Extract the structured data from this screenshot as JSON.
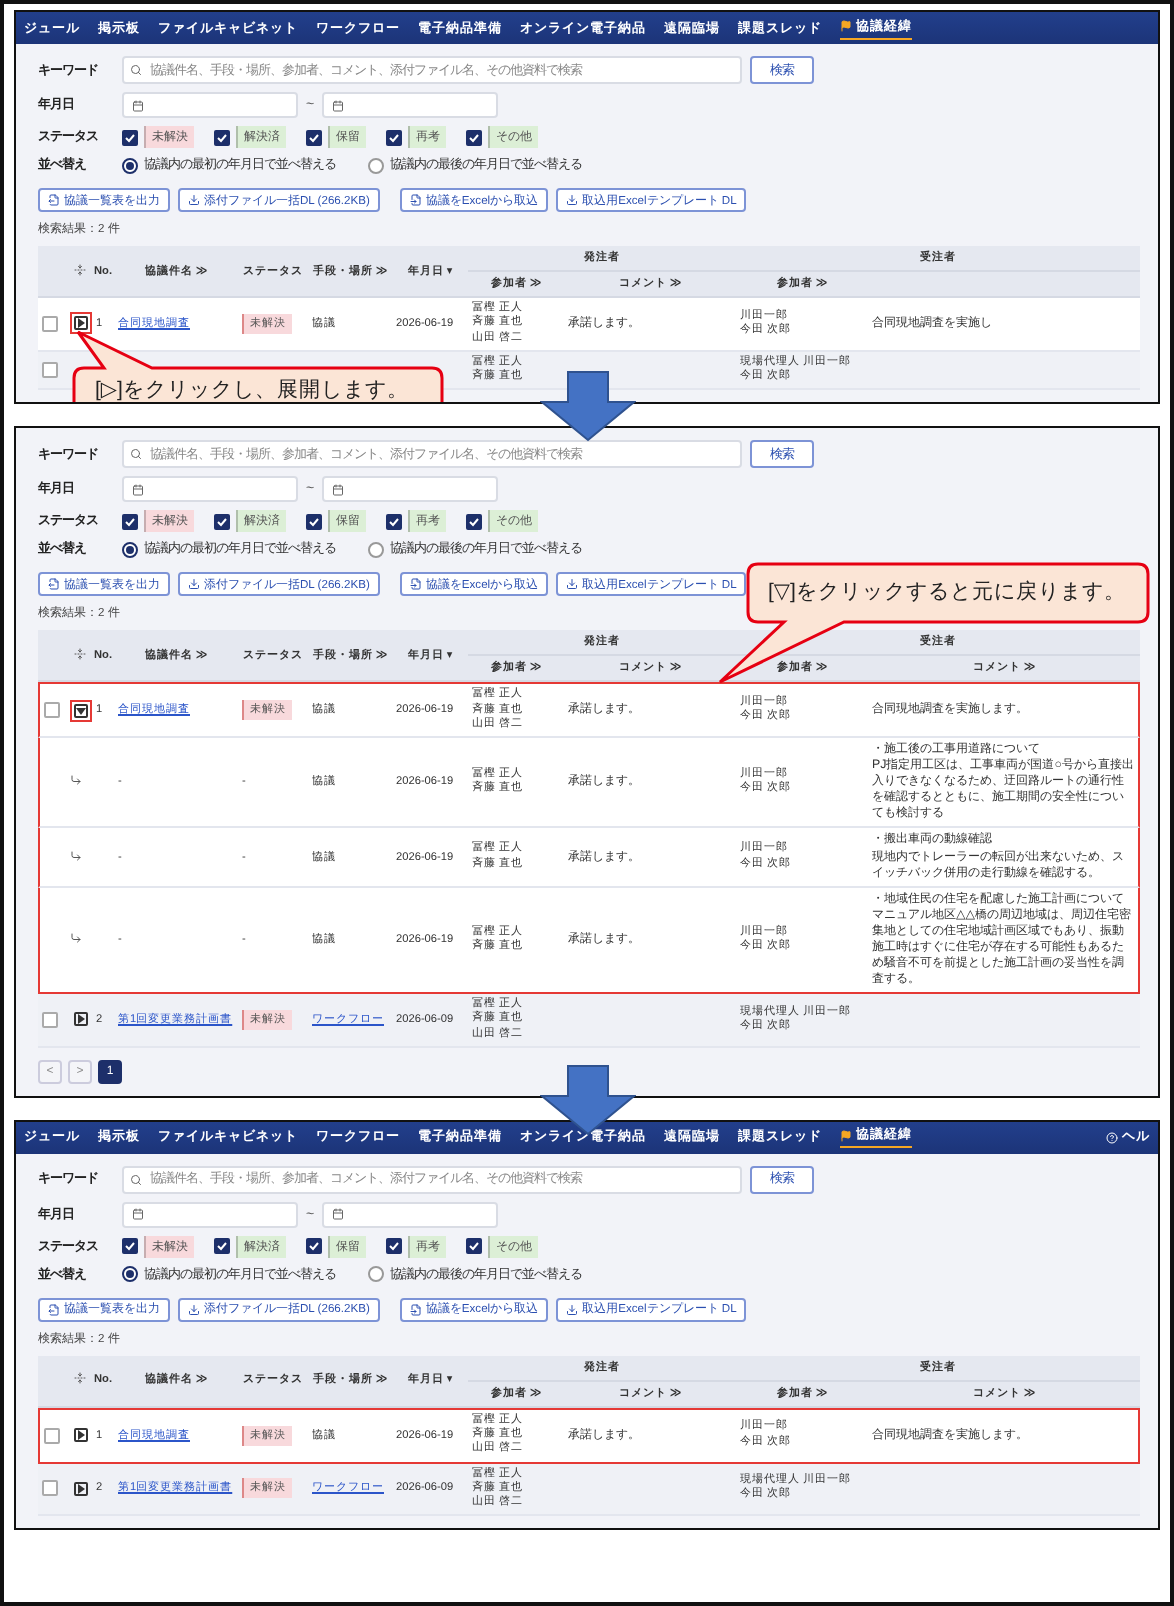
{
  "panels": [
    {
      "nav": {
        "items": [
          {
            "label": "ジュール",
            "selected": false
          },
          {
            "label": "掲示板",
            "selected": false
          },
          {
            "label": "ファイルキャビネット",
            "selected": false
          },
          {
            "label": "ワークフロー",
            "selected": false
          },
          {
            "label": "電子納品準備",
            "selected": false
          },
          {
            "label": "オンライン電子納品",
            "selected": false
          },
          {
            "label": "遠隔臨場",
            "selected": false
          },
          {
            "label": "課題スレッド",
            "selected": false
          },
          {
            "label": "協議経緯",
            "selected": true
          }
        ]
      },
      "keyword": {
        "label": "キーワード",
        "placeholder": "協議件名、手段・場所、参加者、コメント、添付ファイル名、その他資料で検索",
        "button": "検索"
      },
      "date": {
        "label": "年月日",
        "separator": "~"
      },
      "status": {
        "label": "ステータス",
        "options": [
          {
            "label": "未解決",
            "checked": true,
            "color": "#f8d9dc"
          },
          {
            "label": "解決済",
            "checked": true,
            "color": "#dcefd6"
          },
          {
            "label": "保留",
            "checked": true,
            "color": "#dcefd6"
          },
          {
            "label": "再考",
            "checked": true,
            "color": "#dcefd6"
          },
          {
            "label": "その他",
            "checked": true,
            "color": "#dcefd6"
          }
        ]
      },
      "sort": {
        "label": "並べ替え",
        "options": [
          {
            "label": "協議内の最初の年月日で並べ替える",
            "selected": true
          },
          {
            "label": "協議内の最後の年月日で並べ替える",
            "selected": false
          }
        ]
      },
      "actions": [
        "協議一覧表を出力",
        "添付ファイル一括DL (266.2KB)",
        "協議をExcelから取込",
        "取込用Excelテンプレート DL"
      ],
      "result_count": "検索結果：2 件",
      "table": {
        "columns": [
          "No.",
          "協議件名 ≫",
          "ステータス",
          "手段・場所 ≫",
          "年月日 ▾"
        ],
        "groups": [
          {
            "label": "発注者",
            "columns": [
              "参加者 ≫",
              "コメント ≫"
            ]
          },
          {
            "label": "受注者",
            "columns": [
              "参加者 ≫"
            ]
          }
        ],
        "rows": [
          {
            "selected": false,
            "expanded": false,
            "expand_highlighted": true,
            "highlighted": false,
            "no": "1",
            "title": "合同現地調査",
            "status": "未解決",
            "method": "協議",
            "method_link": false,
            "date": "2026-06-19",
            "client_participants": [
              "冨樫 正人",
              "斉藤 直也",
              "山田 啓二"
            ],
            "client_comment": "承諾します。",
            "contractor_participants": [
              "川田一郎",
              "今田 次郎"
            ],
            "contractor_comment": [
              "合同現地調査を実施し"
            ],
            "callout": {
              "kind": "below",
              "text": "[▷]をクリックし、展開します。"
            }
          },
          {
            "selected": false,
            "client_participants": [
              "冨樫 正人",
              "斉藤 直也"
            ],
            "contractor_participants": [
              "現場代理人 川田一郎",
              "今田 次郎"
            ]
          }
        ]
      }
    },
    {
      "keyword": {
        "label": "キーワード",
        "placeholder": "協議件名、手段・場所、参加者、コメント、添付ファイル名、その他資料で検索",
        "button": "検索"
      },
      "date": {
        "label": "年月日",
        "separator": "~"
      },
      "status": {
        "label": "ステータス",
        "options": [
          {
            "label": "未解決",
            "checked": true,
            "color": "#f8d9dc"
          },
          {
            "label": "解決済",
            "checked": true,
            "color": "#dcefd6"
          },
          {
            "label": "保留",
            "checked": true,
            "color": "#dcefd6"
          },
          {
            "label": "再考",
            "checked": true,
            "color": "#dcefd6"
          },
          {
            "label": "その他",
            "checked": true,
            "color": "#dcefd6"
          }
        ]
      },
      "sort": {
        "label": "並べ替え",
        "options": [
          {
            "label": "協議内の最初の年月日で並べ替える",
            "selected": true
          },
          {
            "label": "協議内の最後の年月日で並べ替える",
            "selected": false
          }
        ]
      },
      "actions": [
        "協議一覧表を出力",
        "添付ファイル一括DL (266.2KB)",
        "協議をExcelから取込",
        "取込用Excelテンプレート DL"
      ],
      "result_count": "検索結果：2 件",
      "table": {
        "columns": [
          "No.",
          "協議件名 ≫",
          "ステータス",
          "手段・場所 ≫",
          "年月日 ▾"
        ],
        "groups": [
          {
            "label": "発注者",
            "columns": [
              "参加者 ≫",
              "コメント ≫"
            ]
          },
          {
            "label": "受注者",
            "columns": [
              "参加者 ≫",
              "コメント ≫"
            ]
          }
        ],
        "rows": [
          {
            "selected": false,
            "expanded": true,
            "expand_highlighted": true,
            "highlighted": true,
            "no": "1",
            "title": "合同現地調査",
            "status": "未解決",
            "method": "協議",
            "method_link": false,
            "date": "2026-06-19",
            "client_participants": [
              "冨樫 正人",
              "斉藤 直也",
              "山田 啓二"
            ],
            "client_comment": "承諾します。",
            "contractor_participants": [
              "川田一郎",
              "今田 次郎"
            ],
            "contractor_comment": [
              "合同現地調査を実施します。"
            ],
            "callout": {
              "kind": "above",
              "text": "[▽]をクリックすると元に戻ります。"
            },
            "children": [
              {
                "title": "-",
                "status": "-",
                "method": "協議",
                "date": "2026-06-19",
                "client_participants": [
                  "冨樫 正人",
                  "斉藤 直也"
                ],
                "client_comment": "承諾します。",
                "contractor_participants": [
                  "川田一郎",
                  "今田 次郎"
                ],
                "contractor_comment": [
                  "・施工後の工事用道路について",
                  "PJ指定用工区は、工事車両が国道○号から直接出入りできなくなるため、迂回路ルートの通行性を確認するとともに、施工期間の安全性についても検討する"
                ]
              },
              {
                "title": "-",
                "status": "-",
                "method": "協議",
                "date": "2026-06-19",
                "client_participants": [
                  "冨樫 正人",
                  "斉藤 直也"
                ],
                "client_comment": "承諾します。",
                "contractor_participants": [
                  "川田一郎",
                  "今田 次郎"
                ],
                "contractor_comment": [
                  "・搬出車両の動線確認",
                  "現地内でトレーラーの転回が出来ないため、スイッチバック併用の走行動線を確認する。"
                ]
              },
              {
                "title": "-",
                "status": "-",
                "method": "協議",
                "date": "2026-06-19",
                "client_participants": [
                  "冨樫 正人",
                  "斉藤 直也"
                ],
                "client_comment": "承諾します。",
                "contractor_participants": [
                  "川田一郎",
                  "今田 次郎"
                ],
                "contractor_comment": [
                  "・地域住民の住宅を配慮した施工計画について",
                  "マニュアル地区△△橋の周辺地域は、周辺住宅密集地としての住宅地域計画区域でもあり、振動施工時はすぐに住宅が存在する可能性もあるため騒音不可を前提とした施工計画の妥当性を調査する。"
                ]
              }
            ]
          },
          {
            "selected": false,
            "expanded": false,
            "expand_highlighted": false,
            "highlighted": false,
            "no": "2",
            "title": "第1回変更業務計画書",
            "status": "未解決",
            "method": "ワークフロー",
            "method_link": true,
            "date": "2026-06-09",
            "client_participants": [
              "冨樫 正人",
              "斉藤 直也",
              "山田 啓二"
            ],
            "contractor_participants": [
              "現場代理人 川田一郎",
              "今田 次郎"
            ]
          }
        ]
      },
      "pagination": [
        {
          "label": "<",
          "selected": false
        },
        {
          "label": ">",
          "selected": false
        },
        {
          "label": "1",
          "selected": true
        }
      ]
    },
    {
      "nav": {
        "items": [
          {
            "label": "ジュール",
            "selected": false
          },
          {
            "label": "掲示板",
            "selected": false
          },
          {
            "label": "ファイルキャビネット",
            "selected": false
          },
          {
            "label": "ワークフロー",
            "selected": false
          },
          {
            "label": "電子納品準備",
            "selected": false
          },
          {
            "label": "オンライン電子納品",
            "selected": false
          },
          {
            "label": "遠隔臨場",
            "selected": false
          },
          {
            "label": "課題スレッド",
            "selected": false
          },
          {
            "label": "協議経緯",
            "selected": true
          }
        ],
        "help": "ヘル"
      },
      "keyword": {
        "label": "キーワード",
        "placeholder": "協議件名、手段・場所、参加者、コメント、添付ファイル名、その他資料で検索",
        "button": "検索"
      },
      "date": {
        "label": "年月日",
        "separator": "~"
      },
      "status": {
        "label": "ステータス",
        "options": [
          {
            "label": "未解決",
            "checked": true,
            "color": "#f8d9dc"
          },
          {
            "label": "解決済",
            "checked": true,
            "color": "#dcefd6"
          },
          {
            "label": "保留",
            "checked": true,
            "color": "#dcefd6"
          },
          {
            "label": "再考",
            "checked": true,
            "color": "#dcefd6"
          },
          {
            "label": "その他",
            "checked": true,
            "color": "#dcefd6"
          }
        ]
      },
      "sort": {
        "label": "並べ替え",
        "options": [
          {
            "label": "協議内の最初の年月日で並べ替える",
            "selected": true
          },
          {
            "label": "協議内の最後の年月日で並べ替える",
            "selected": false
          }
        ]
      },
      "actions": [
        "協議一覧表を出力",
        "添付ファイル一括DL (266.2KB)",
        "協議をExcelから取込",
        "取込用Excelテンプレート DL"
      ],
      "result_count": "検索結果：2 件",
      "table": {
        "columns": [
          "No.",
          "協議件名 ≫",
          "ステータス",
          "手段・場所 ≫",
          "年月日 ▾"
        ],
        "groups": [
          {
            "label": "発注者",
            "columns": [
              "参加者 ≫",
              "コメント ≫"
            ]
          },
          {
            "label": "受注者",
            "columns": [
              "参加者 ≫",
              "コメント ≫"
            ]
          }
        ],
        "rows": [
          {
            "selected": false,
            "expanded": false,
            "expand_highlighted": false,
            "highlighted": true,
            "no": "1",
            "title": "合同現地調査",
            "status": "未解決",
            "method": "協議",
            "method_link": false,
            "date": "2026-06-19",
            "client_participants": [
              "冨樫 正人",
              "斉藤 直也",
              "山田 啓二"
            ],
            "client_comment": "承諾します。",
            "contractor_participants": [
              "川田一郎",
              "今田 次郎"
            ],
            "contractor_comment": [
              "合同現地調査を実施します。"
            ]
          },
          {
            "selected": false,
            "expanded": false,
            "expand_highlighted": false,
            "highlighted": false,
            "no": "2",
            "title": "第1回変更業務計画書",
            "status": "未解決",
            "method": "ワークフロー",
            "method_link": true,
            "date": "2026-06-09",
            "client_participants": [
              "冨樫 正人",
              "斉藤 直也",
              "山田 啓二"
            ],
            "contractor_participants": [
              "現場代理人 川田一郎",
              "今田 次郎"
            ]
          }
        ]
      }
    }
  ]
}
